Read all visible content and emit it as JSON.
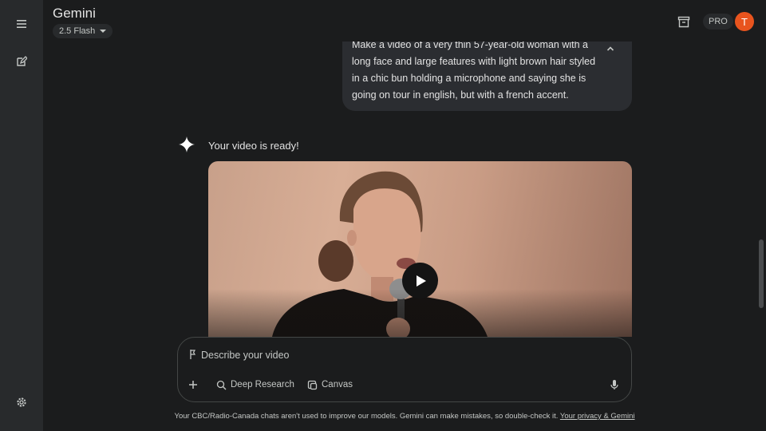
{
  "app": {
    "title": "Gemini",
    "model": "2.5 Flash"
  },
  "header": {
    "badge": "PRO",
    "avatar_initial": "T",
    "avatar_color": "#e8541e"
  },
  "chat": {
    "user_message": "Make a video of a very thin 57-year-old woman with a long face and large features with light brown hair styled in a chic bun holding a microphone and saying she is going on tour in english, but with a french accent.",
    "assistant_message": "Your video is ready!"
  },
  "composer": {
    "placeholder": "Describe your video",
    "tools": [
      "Deep Research",
      "Canvas"
    ]
  },
  "footer": {
    "disclaimer": "Your CBC/Radio-Canada chats aren't used to improve our models. Gemini can make mistakes, so double-check it.",
    "privacy_link": "Your privacy & Gemini"
  },
  "icons": {
    "sidebar": [
      "menu-icon",
      "new-chat-icon",
      "settings-icon"
    ],
    "header": [
      "archive-icon"
    ],
    "composer": [
      "plus-icon",
      "deep-research-icon",
      "canvas-icon",
      "mic-icon"
    ],
    "chat": [
      "gemini-spark-icon",
      "collapse-chevron-icon",
      "play-icon"
    ]
  }
}
